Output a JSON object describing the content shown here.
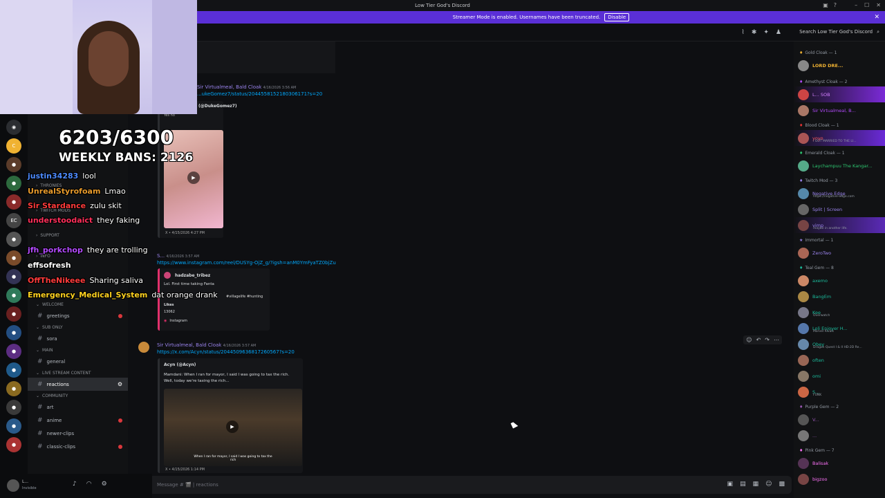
{
  "window": {
    "title": "Low Tier God's Discord"
  },
  "banner": {
    "text": "Streamer Mode is enabled. Usernames have been truncated.",
    "button": "Disable"
  },
  "search": {
    "placeholder": "Search Low Tier God's Discord"
  },
  "overlay": {
    "count": "6203/6300",
    "bans": "WEEKLY BANS: 2126"
  },
  "stream_chat": [
    {
      "user": "justin34283",
      "msg": "lool",
      "color": "#4d8bff"
    },
    {
      "user": "UnrealStyrofoam",
      "msg": "Lmao",
      "color": "#e89b2c"
    },
    {
      "user": "Sir Stardance",
      "msg": "zulu skit",
      "color": "#ff3b3b"
    },
    {
      "user": "understoodaict",
      "msg": "they faking",
      "color": "#ff2f5a"
    },
    {
      "user": "jfh_porkchop",
      "msg": "they are trolling",
      "color": "#b44bff"
    },
    {
      "user": "effsofresh",
      "msg": "",
      "color": "#ffffff"
    },
    {
      "user": "OffTheNikeee",
      "msg": "Sharing saliva",
      "color": "#ff3b3b"
    },
    {
      "user": "Emergency_Medical_System",
      "msg": "dat orange drank",
      "color": "#ffd21f"
    }
  ],
  "channels": {
    "cats": {
      "welcome": "WELCOME",
      "sub_only": "SUB ONLY",
      "main": "MAIN",
      "live": "LIVE STREAM CONTENT",
      "community": "COMMUNITY",
      "support": "SUPPORT",
      "info": "INFO",
      "twitch_mods": "TWITCH MODS",
      "thronies": "THRONIES"
    },
    "greetings": "greetings",
    "sora": "sora",
    "general": "general",
    "reactions": "reactions",
    "art": "art",
    "anime": "anime",
    "newer_clips": "newer-clips",
    "classic_clips": "classic-clips"
  },
  "messages": {
    "m1_user": "Sir Virtualmeal, Bald Cloak",
    "m1_time": "4/16/2026 3:56 AM",
    "m1_link": "...ukeGomez7/status/2044558152180306171?s=20",
    "m1_embed_author": "(@DukeGomez7)",
    "m1_embed_text": "Yes no",
    "m1_embed_footer": "X • 4/15/2026 4:27 PM",
    "m2_user": "S...",
    "m2_time": "4/16/2026 3:57 AM",
    "m2_link": "https://www.instagram.com/reel/DUSYg-OjZ_g/?igsh=anM0YmFyaTZ0bjZu",
    "m2_embed_author": "hadzabe_tribez",
    "m2_embed_text": "Lol. First time taking Fanta",
    "m2_embed_tags": "#villagelife #hunting",
    "m2_likes_label": "Likes",
    "m2_likes": "13062",
    "m2_footer": "Instagram",
    "m3_user": "Sir Virtualmeal, Bald Cloak",
    "m3_time": "4/16/2026 3:57 AM",
    "m3_link": "https://x.com/Acyn/status/2044509636817260567?s=20",
    "m3_embed_author": "Acyn (@Acyn)",
    "m3_embed_text": "Mamdani: When I ran for mayor, I said I was going to tax the rich. Well, today we're taxing the rich...",
    "m3_video_caption": "When I ran for mayor, I said I was going to tax the rich",
    "m3_footer": "X • 4/15/2026 1:14 PM"
  },
  "input": {
    "placeholder": "Message # 🎬 | reactions"
  },
  "members": {
    "gold_cloak": "Gold Cloak — 1",
    "gold_name": "LORD DRE...",
    "amethyst_cloak": "Amethyst Cloak — 2",
    "amethyst_1": "L... SOB",
    "amethyst_2": "Sir Virtualmeal, B...",
    "blood_cloak": "Blood Cloak — 1",
    "blood_1": "yoyo",
    "blood_1_sub": "I GOT MARRIED TO THE LI...",
    "emerald_cloak": "Emerald Cloak — 1",
    "emerald_1": "Laychampuu The Kangar...",
    "twitch_mod": "Twitch Mod — 3",
    "mod_1": "Negative Edge",
    "mod_1_sub": "https://negative-edge.com",
    "mod_2": "Split | Screen",
    "mod_3": "vimp",
    "mod_3_sub": "maybe in another life.",
    "immortal": "Immortal — 1",
    "imm_1": "ZeroTwo",
    "teal_gem": "Teal Gem — 8",
    "teal_1": "axemo",
    "teal_2": "BangEm",
    "teal_3": "Kee",
    "teal_3_sub": "Overwatch",
    "teal_4": "Loli Enjoyer H...",
    "teal_4_sub": "Marvel Rivals",
    "teal_5": "Obey",
    "teal_5_sub": "Dragon Quest I & II HD-2D Re...",
    "teal_6": "often",
    "teal_7": "omi",
    "teal_8": "S...",
    "teal_8_sub": "FUNK",
    "purple_gem": "Purple Gem — 2",
    "purple_1": "V...",
    "purple_2": "...",
    "pink_gem": "Pink Gem — 7",
    "pink_1": "Balisak",
    "pink_2": "bigzoo"
  },
  "userbar": {
    "name": "L...",
    "status": "Invisible"
  }
}
